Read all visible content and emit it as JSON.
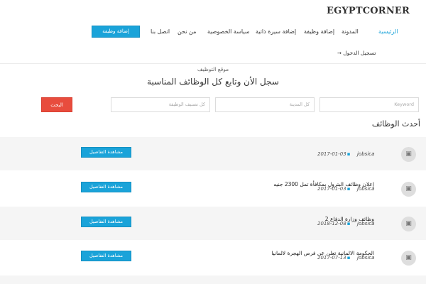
{
  "site": {
    "logo": "EGYPTCORNER"
  },
  "nav": {
    "home": "الرئيسية",
    "blog": "المدونة",
    "add_job": "إضافة وظيفة",
    "add_cv": "إضافة سيرة ذاتية",
    "privacy": "سياسة الخصوصية",
    "about": "من نحن",
    "contact": "اتصل بنا",
    "post_job_button": "إضافة وظيفة",
    "login": "تسجيل الدخول"
  },
  "hero": {
    "subtitle": "موقع التوظيف",
    "title": "سجل الأن وتابع كل الوظائف المناسبة"
  },
  "search": {
    "keyword_placeholder": "Keyword",
    "city_placeholder": "كل المدينة",
    "category_placeholder": "كل تصنيف الوظيفة",
    "button_label": "البحث"
  },
  "latest": {
    "title": "أحدث الوظائف"
  },
  "jobs": [
    {
      "title": "",
      "company": "jobsica",
      "date": "2017-01-03",
      "button": "مشاهدة التفاصيل"
    },
    {
      "title": "إعلان وظائف البترول بمكافأة تمل 2300 جنيه",
      "company": "jobsica",
      "date": "2017-01-03",
      "button": "مشاهدة التفاصيل"
    },
    {
      "title": "وظائف وزارة الدفاع 2",
      "company": "jobsica",
      "date": "2018-12-08",
      "button": "مشاهدة التفاصيل"
    },
    {
      "title": "الحكومة الالمانية تعلن عن فرص الهجرة لالمانيا",
      "company": "jobsica",
      "date": "2017-07-13",
      "button": "مشاهدة التفاصيل"
    }
  ],
  "colors": {
    "accent": "#1aa3d9",
    "search_button": "#e84c3d",
    "row_alt": "#f5f5f5"
  }
}
